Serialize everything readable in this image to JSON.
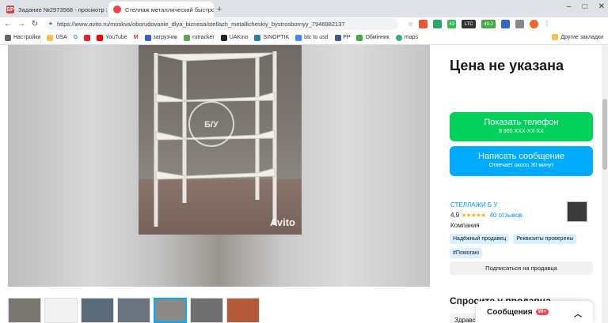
{
  "browser": {
    "tabs": [
      {
        "label": "Задание №2973568 - просмотр з",
        "favicon": "SP"
      },
      {
        "label": "Стеллаж металлический быстро",
        "favicon": "A"
      }
    ],
    "url": "https://www.avito.ru/moskva/oborudovanie_dlya_biznesa/stellazh_metallicheskiy_bystrosbornyy_7946982137",
    "bookmarks": [
      "Настройки",
      "USA",
      "G",
      "YouTube",
      "M",
      "загрузчик",
      "rutracker",
      "UAKino",
      "SINOPTIK",
      "btc to usd",
      "FP",
      "Обмінник",
      "maps"
    ],
    "other_bookmarks": "Другие закладки",
    "extensions": [
      "43",
      "LTC",
      "49.2"
    ]
  },
  "listing": {
    "watermark": "Avito",
    "price": "Цена не указана",
    "show_phone": {
      "label": "Показать телефон",
      "sub": "8 965 XXX-XX-XX"
    },
    "message": {
      "label": "Написать сообщение",
      "sub": "Отвечает около 30 минут"
    },
    "seller": {
      "name": "СТЕЛЛАЖИ Б У",
      "rating": "4,9",
      "stars": "★★★★★",
      "reviews": "40 отзывов",
      "type": "Компания"
    },
    "badges": [
      "Надёжный продавец",
      "Реквизиты проверены",
      "#Помогаю"
    ],
    "subscribe": "Подписаться на продавца",
    "ask_title": "Спросите у продавца",
    "ask_input": "Здравс"
  },
  "messages": {
    "label": "Сообщения",
    "count": "99+"
  },
  "colors": {
    "green": "#02d15c",
    "blue": "#00aaff",
    "link": "#0099f7"
  }
}
